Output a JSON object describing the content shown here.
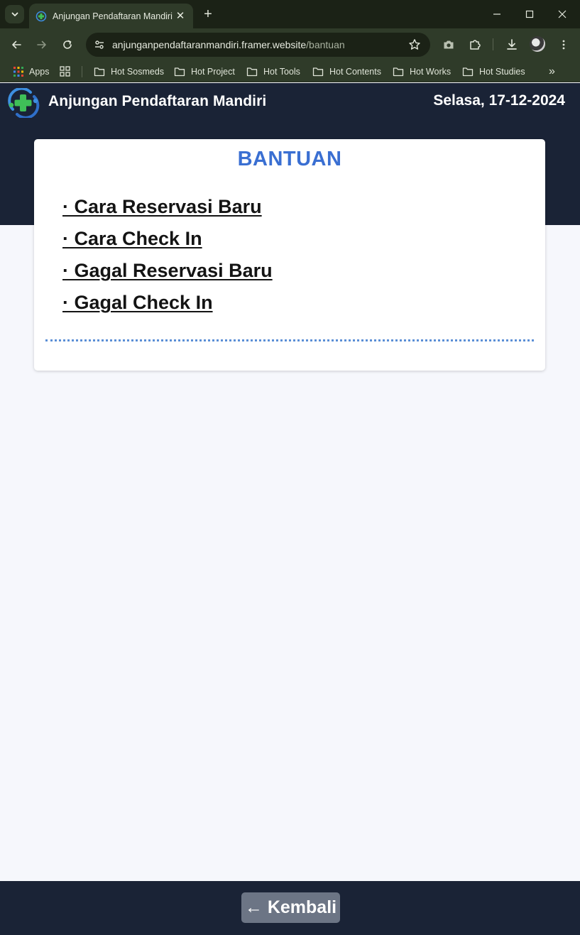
{
  "browser": {
    "tab_title": "Anjungan Pendaftaran Mandiri",
    "url_host": "anjunganpendaftaranmandiri.framer.website",
    "url_path": "/bantuan",
    "new_tab_label": "+",
    "tab_close_label": "✕",
    "bookmarks": [
      {
        "label": "Apps",
        "icon": "apps-grid-icon"
      },
      {
        "label": "Hot Sosmeds",
        "icon": "folder-icon"
      },
      {
        "label": "Hot Project",
        "icon": "folder-icon"
      },
      {
        "label": "Hot Tools",
        "icon": "folder-icon"
      },
      {
        "label": "Hot Contents",
        "icon": "folder-icon"
      },
      {
        "label": "Hot Works",
        "icon": "folder-icon"
      },
      {
        "label": "Hot Studies",
        "icon": "folder-icon"
      }
    ],
    "overflow_label": "»"
  },
  "header": {
    "title": "Anjungan Pendaftaran Mandiri",
    "date": "Selasa, 17-12-2024"
  },
  "card": {
    "title": "BANTUAN",
    "links": [
      "· Cara Reservasi Baru",
      "· Cara Check In",
      "· Gagal Reservasi Baru",
      "· Gagal Check In"
    ]
  },
  "footer": {
    "back_label": "← Kembali"
  },
  "colors": {
    "navy": "#1a2336",
    "accent_blue": "#3a6fd2",
    "page_bg": "#f6f7fc",
    "button_gray": "#6c7585"
  }
}
